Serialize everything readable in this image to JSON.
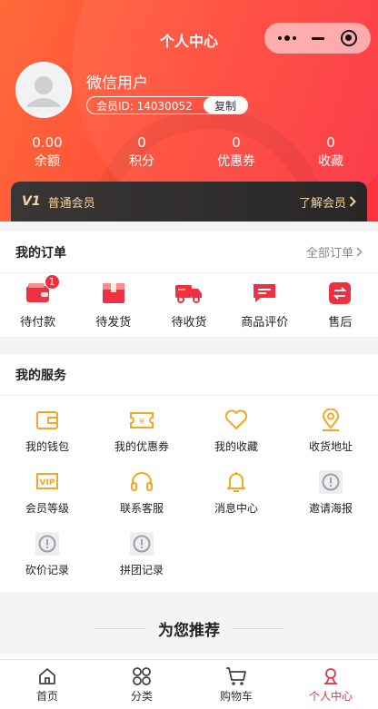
{
  "header": {
    "title": "个人中心"
  },
  "user": {
    "name": "微信用户",
    "member_id": "会员ID: 14030052",
    "copy_label": "复制"
  },
  "stats": [
    {
      "value": "0.00",
      "label": "余额"
    },
    {
      "value": "0",
      "label": "积分"
    },
    {
      "value": "0",
      "label": "优惠券"
    },
    {
      "value": "0",
      "label": "收藏"
    }
  ],
  "vip": {
    "tag": "V1",
    "level": "普通会员",
    "more": "了解会员"
  },
  "orders": {
    "title": "我的订单",
    "more": "全部订单",
    "items": [
      {
        "label": "待付款",
        "icon": "wallet-icon",
        "badge": "1"
      },
      {
        "label": "待发货",
        "icon": "package-icon"
      },
      {
        "label": "待收货",
        "icon": "truck-icon"
      },
      {
        "label": "商品评价",
        "icon": "comment-icon"
      },
      {
        "label": "售后",
        "icon": "exchange-icon"
      }
    ]
  },
  "services": {
    "title": "我的服务",
    "items": [
      {
        "label": "我的钱包",
        "icon": "wallet-icon"
      },
      {
        "label": "我的优惠券",
        "icon": "coupon-icon"
      },
      {
        "label": "我的收藏",
        "icon": "heart-icon"
      },
      {
        "label": "收货地址",
        "icon": "location-icon"
      },
      {
        "label": "会员等级",
        "icon": "vip-icon"
      },
      {
        "label": "联系客服",
        "icon": "headset-icon"
      },
      {
        "label": "消息中心",
        "icon": "bell-icon"
      },
      {
        "label": "邀请海报",
        "icon": "placeholder-icon"
      },
      {
        "label": "砍价记录",
        "icon": "placeholder-icon"
      },
      {
        "label": "拼团记录",
        "icon": "placeholder-icon"
      }
    ]
  },
  "recommend": {
    "title": "为您推荐"
  },
  "tabbar": [
    {
      "label": "首页",
      "icon": "home-icon"
    },
    {
      "label": "分类",
      "icon": "category-icon"
    },
    {
      "label": "购物车",
      "icon": "cart-icon"
    },
    {
      "label": "个人中心",
      "icon": "user-icon",
      "active": true
    }
  ],
  "colors": {
    "accent": "#f03040",
    "service_icon": "#f5a623",
    "vip_text": "#f3d39f"
  }
}
